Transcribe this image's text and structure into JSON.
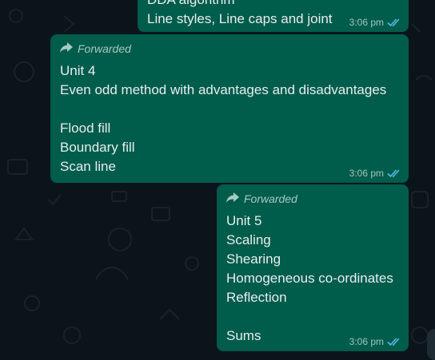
{
  "messages": [
    {
      "forwarded_label": "",
      "lines": [
        "DDA algorithm",
        "Line styles, Line caps and joint"
      ],
      "time": "3:06 pm",
      "status_icon": "double-check-icon"
    },
    {
      "forwarded_label": "Forwarded",
      "lines": [
        "Unit 4",
        "Even odd method with advantages and disadvantages",
        "",
        "Flood fill",
        "Boundary fill",
        "Scan line"
      ],
      "time": "3:06 pm",
      "status_icon": "double-check-icon"
    },
    {
      "forwarded_label": "Forwarded",
      "lines": [
        "Unit 5",
        "Scaling",
        "Shearing",
        "Homogeneous co-ordinates",
        "Reflection",
        "",
        "Sums"
      ],
      "time": "3:06 pm",
      "status_icon": "double-check-icon"
    }
  ],
  "colors": {
    "background": "#0b141a",
    "outgoing_bubble": "#005c4b",
    "read_ticks": "#53bdeb"
  }
}
